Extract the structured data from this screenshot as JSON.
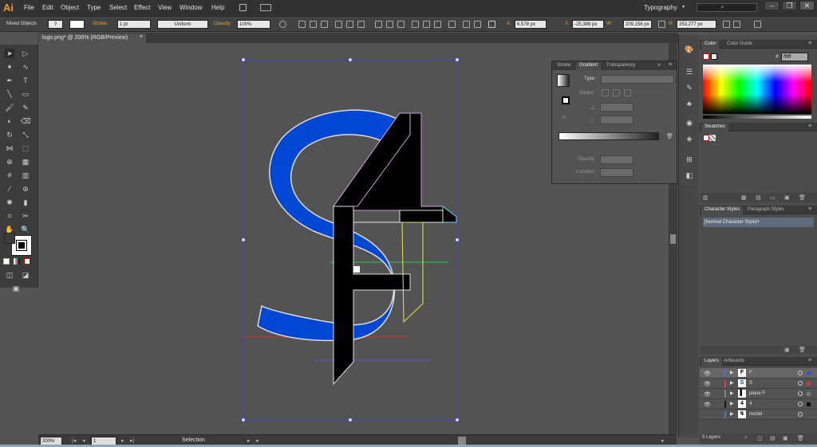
{
  "app": {
    "logo": "Ai",
    "workspace": "Typography",
    "search_placeholder": "",
    "window_controls": [
      "–",
      "❐",
      "✕"
    ]
  },
  "menu": [
    "File",
    "Edit",
    "Object",
    "Type",
    "Select",
    "Effect",
    "View",
    "Window",
    "Help"
  ],
  "options": {
    "selection_label": "Mixed Objects",
    "stroke_label": "Stroke:",
    "stroke_weight": "1 pt",
    "stroke_profile": "Uniform",
    "opacity_label": "Opacity:",
    "opacity_value": "100%",
    "x_label": "X:",
    "x_value": "6,578 px",
    "y_label": "Y:",
    "y_value": "-25,389 px",
    "w_label": "W:",
    "w_value": "209,156 px",
    "h_label": "H:",
    "h_value": "353,277 px"
  },
  "document_tab": {
    "title": "logo.png* @ 200% (RGB/Preview)",
    "close": "×"
  },
  "status": {
    "zoom": "200%",
    "page": "1",
    "tool": "Selection"
  },
  "gradient_panel": {
    "tabs": [
      "Stroke",
      "Gradient",
      "Transparency"
    ],
    "type_label": "Type:",
    "stroke_label": "Stroke:",
    "opacity_label": "Opacity:",
    "location_label": "Location:"
  },
  "color_panel": {
    "tabs": [
      "Color",
      "Color Guide"
    ],
    "hex_label": "#",
    "hex_value": "ffffff"
  },
  "swatches_panel": {
    "tabs": [
      "Swatches"
    ]
  },
  "char_styles_panel": {
    "tabs": [
      "Character Styles",
      "Paragraph Styles"
    ],
    "item": "[Normal Character Style]+"
  },
  "layers_panel": {
    "tabs": [
      "Layers",
      "Artboards"
    ],
    "layers": [
      {
        "name": "F",
        "thumb": "F",
        "color": "#4f6ecf",
        "square": "#3153d6",
        "selected": true
      },
      {
        "name": "S",
        "thumb": "S",
        "color": "#d94848",
        "square": "#e03030",
        "selected": false
      },
      {
        "name": "pique F",
        "thumb": "▌",
        "color": "#888888",
        "square": "#777777",
        "selected": false
      },
      {
        "name": "4",
        "thumb": "4",
        "color": "#1a1a1a",
        "square": "#111111",
        "selected": false
      },
      {
        "name": "model",
        "thumb": "↯",
        "color": "#4f6ecf",
        "square": "",
        "selected": false
      }
    ],
    "count": "5 Layers"
  },
  "colors": {
    "s_fill": "#0047d6",
    "s_outline": "#dcdcdc",
    "black": "#000000",
    "guide_red": "#c0392b",
    "guide_blue": "#5b5bd6",
    "guide_green": "#22cc44",
    "bbox": "#4a44c8"
  }
}
